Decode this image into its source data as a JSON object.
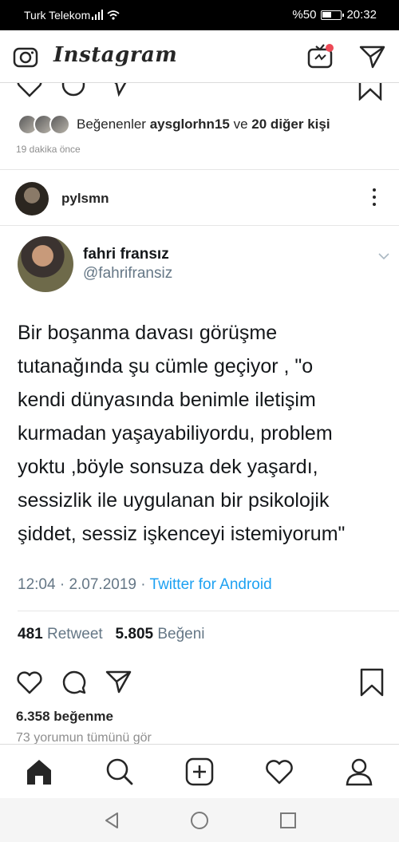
{
  "status_bar": {
    "carrier": "Turk Telekom",
    "battery": "%50",
    "time": "20:32"
  },
  "app": {
    "logo_text": "Instagram"
  },
  "previous_post": {
    "liked_by_prefix": "Beğenenler",
    "liked_by_user": "aysglorhn15",
    "liked_by_conj": "ve",
    "liked_by_others": "20 diğer kişi",
    "time_ago": "19 dakika önce"
  },
  "post": {
    "username": "pylsmn",
    "tweet": {
      "name": "fahri fransız",
      "handle": "@fahrifransiz",
      "text": "Bir boşanma davası görüşme\ntutanağında şu cümle geçiyor , \"o\nkendi dünyasında benimle iletişim\nkurmadan yaşayabiliyordu,  problem\nyoktu ,böyle sonsuza dek yaşardı,\nsessizlik ile uygulanan bir psikolojik\nşiddet, sessiz işkenceyi istemiyorum\"",
      "time": "12:04",
      "date": "2.07.2019",
      "source": "Twitter for Android",
      "retweets": "481",
      "retweets_label": "Retweet",
      "likes": "5.805",
      "likes_label": "Beğeni"
    },
    "likes_text": "6.358 beğenme",
    "comments_text": "73 yorumun tümünü gör"
  },
  "icons": {
    "camera": "camera-icon",
    "igtv": "igtv-icon",
    "direct": "direct-icon",
    "heart": "heart-icon",
    "comment": "comment-icon",
    "share": "share-icon",
    "bookmark": "bookmark-icon",
    "home": "home-icon",
    "search": "search-icon",
    "add": "add-icon",
    "activity": "activity-icon",
    "profile": "profile-icon"
  },
  "colors": {
    "twitter_blue": "#1da1f2",
    "notification_dot": "#ed4956"
  }
}
